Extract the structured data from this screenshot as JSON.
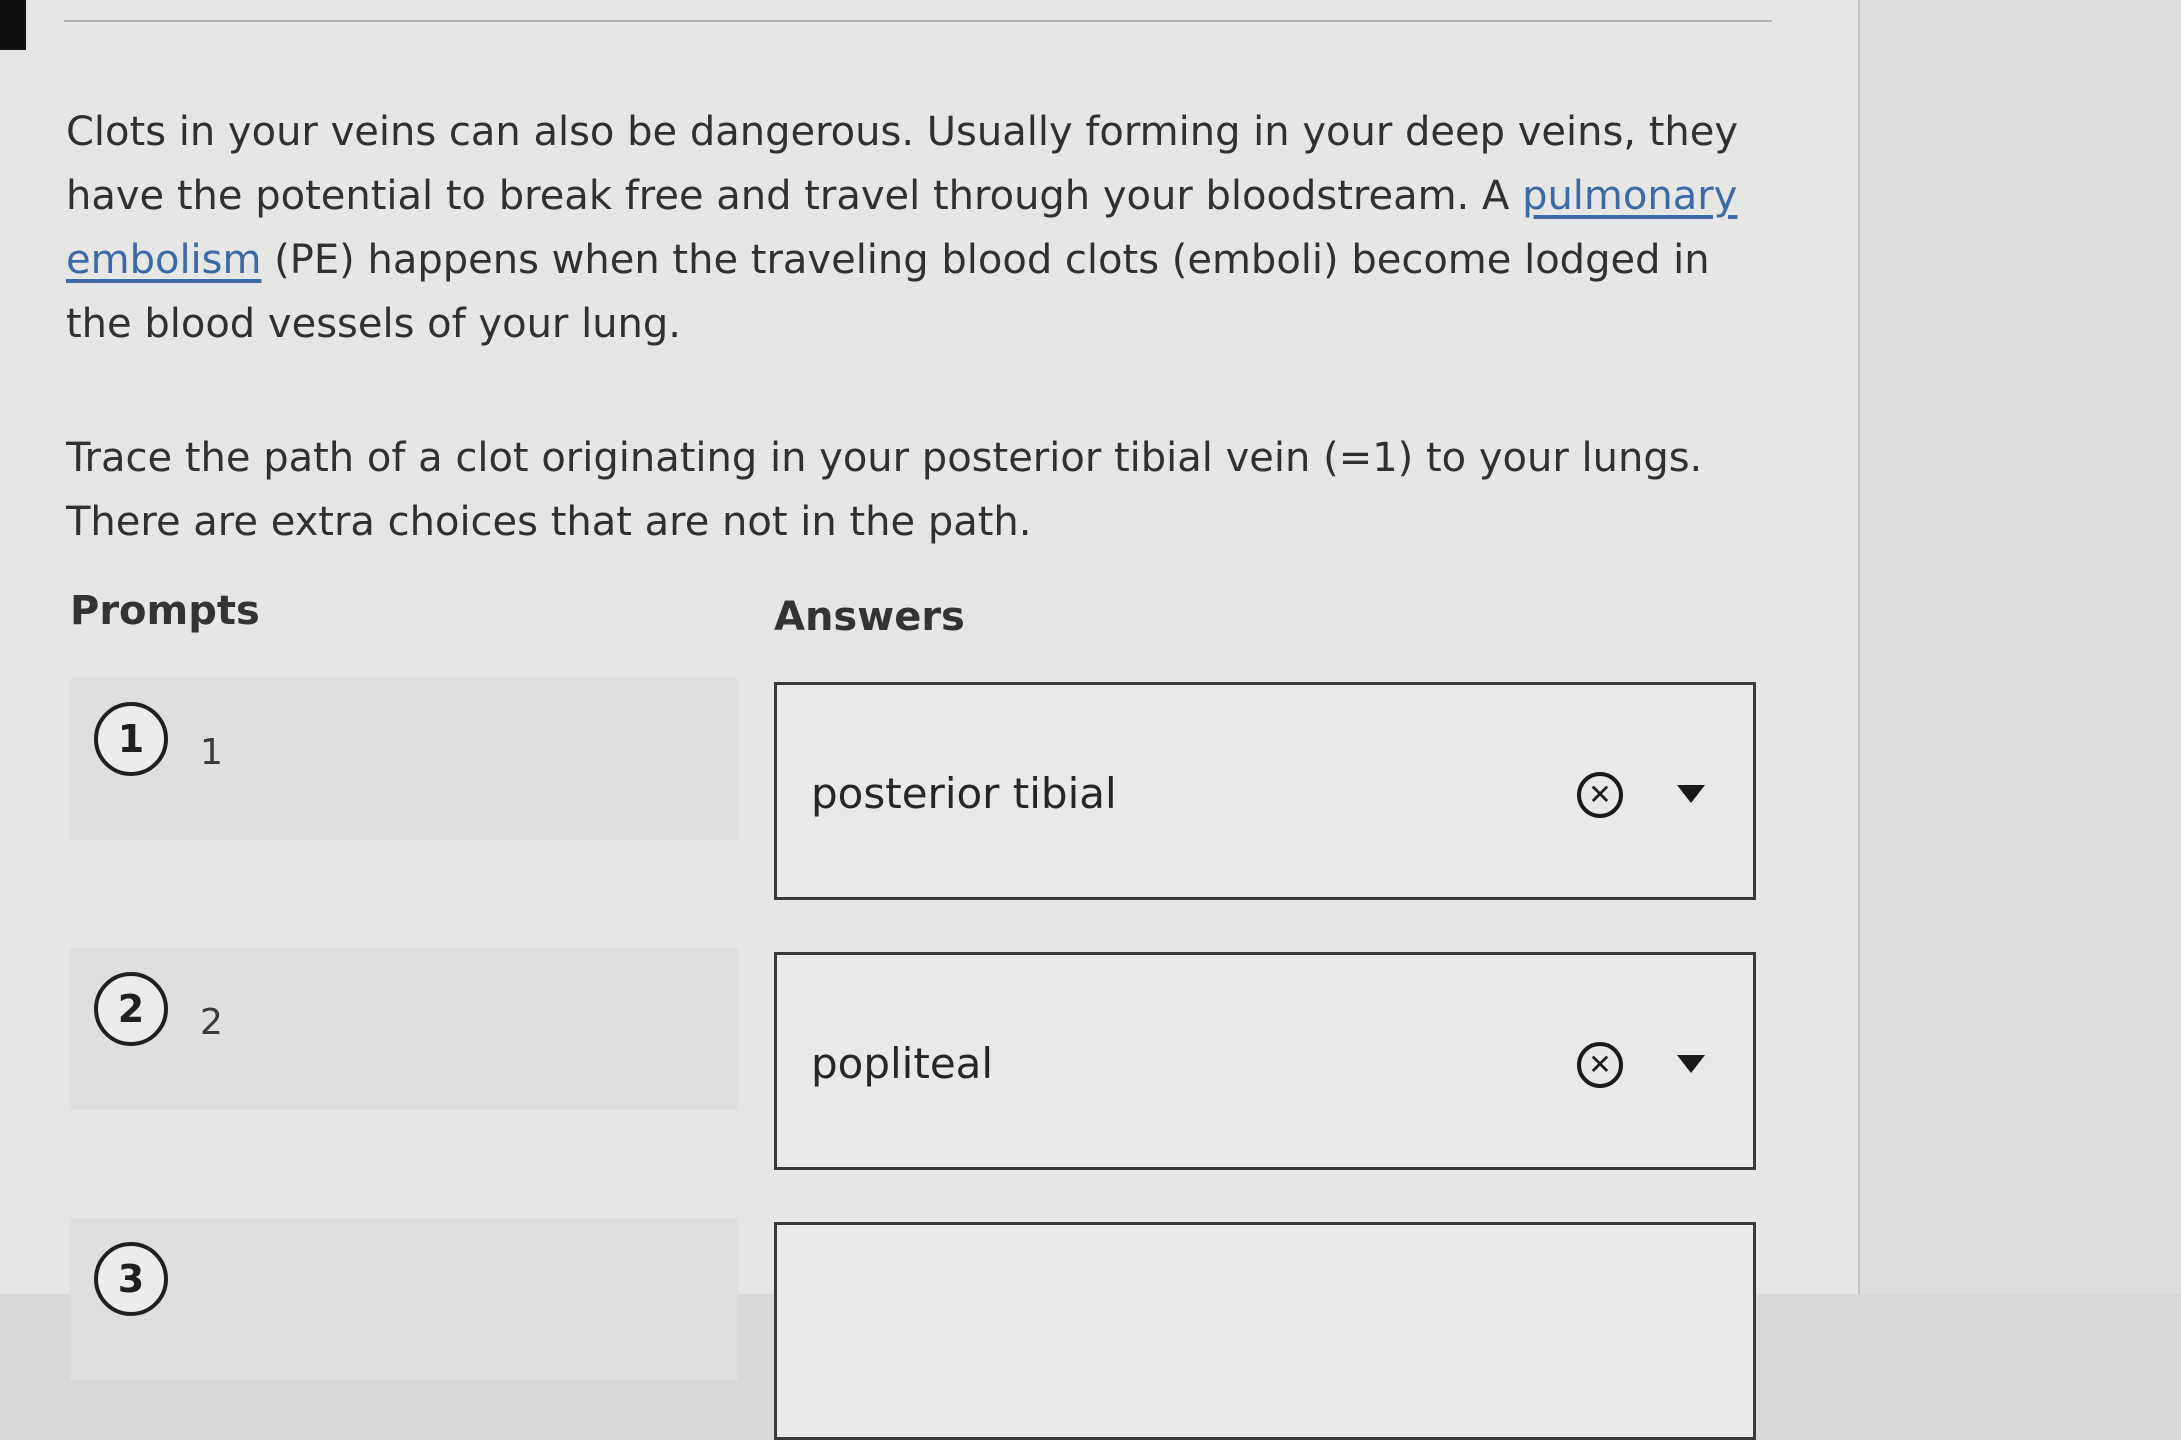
{
  "content": {
    "paragraph1_before_link": "Clots in your veins can also be dangerous. Usually forming in your deep veins, they have the potential to break free and travel through your bloodstream. A ",
    "link_text": "pulmonary embolism",
    "paragraph1_after_link": " (PE) happens when the traveling blood clots (emboli) become lodged in the blood vessels of your lung.",
    "paragraph2": "Trace the path of a clot originating in your posterior tibial vein (=1) to your lungs. There are extra choices that are not in the path."
  },
  "columns": {
    "prompts": "Prompts",
    "answers": "Answers"
  },
  "prompts": [
    {
      "number": "1",
      "label": "1"
    },
    {
      "number": "2",
      "label": "2"
    },
    {
      "number": "3",
      "label": ""
    }
  ],
  "answers": [
    {
      "value": "posterior tibial",
      "clear_icon": "clear-circle-x-icon",
      "dropdown_icon": "caret-down-icon"
    },
    {
      "value": "popliteal",
      "clear_icon": "clear-circle-x-icon",
      "dropdown_icon": "caret-down-icon"
    },
    {
      "value": ""
    }
  ],
  "colors": {
    "link": "#3a6aa8",
    "panel_background": "#e6e6e4"
  }
}
